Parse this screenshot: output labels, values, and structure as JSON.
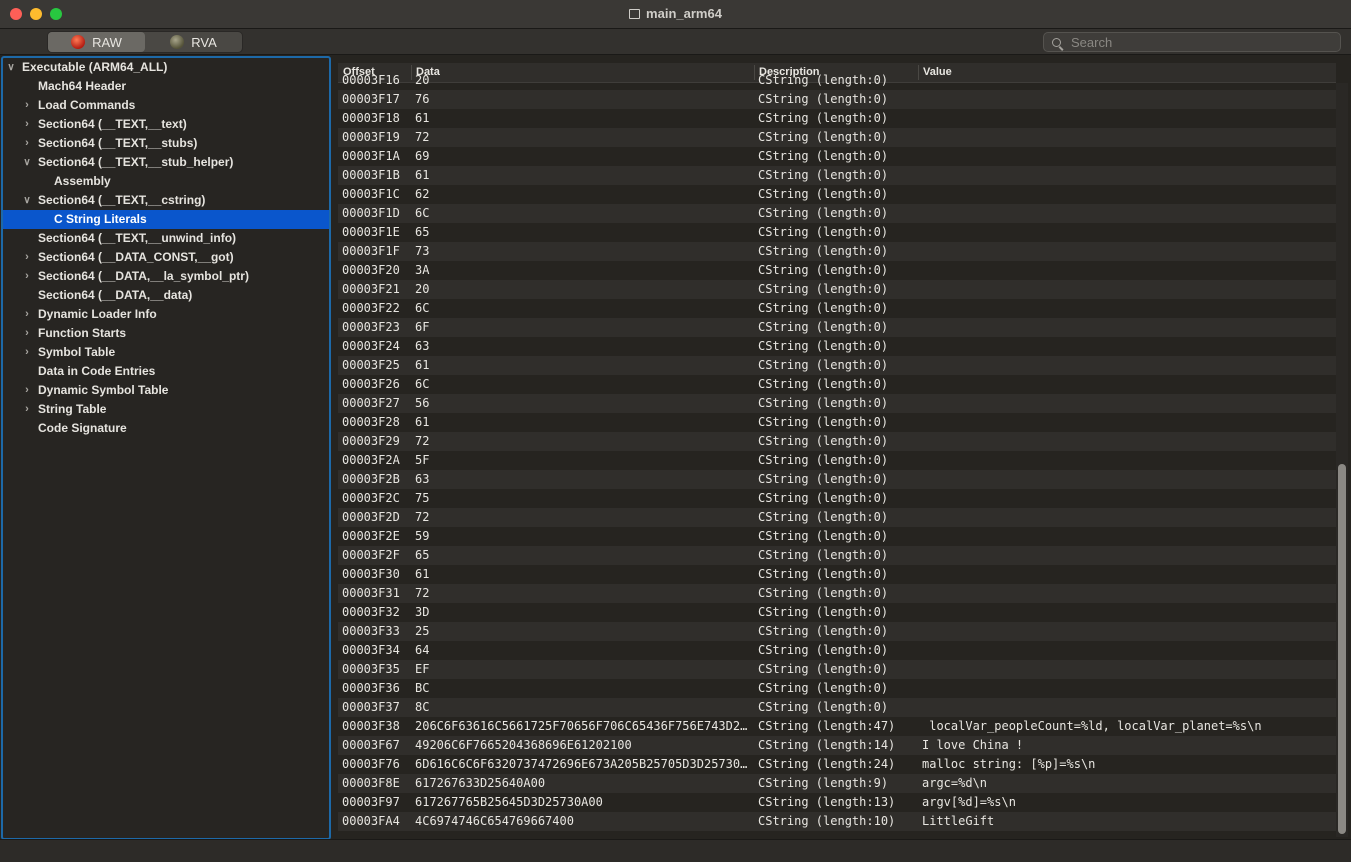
{
  "window": {
    "title": "main_arm64"
  },
  "toolbar": {
    "modes": [
      {
        "label": "RAW",
        "icon": "raw-icon",
        "active": true
      },
      {
        "label": "RVA",
        "icon": "rva-icon",
        "active": false
      }
    ],
    "search_placeholder": "Search"
  },
  "sidebar": {
    "items": [
      {
        "label": "Executable  (ARM64_ALL)",
        "level": 0,
        "chevron": "open"
      },
      {
        "label": "Mach64 Header",
        "level": 1,
        "chevron": "none"
      },
      {
        "label": "Load Commands",
        "level": 1,
        "chevron": "closed"
      },
      {
        "label": "Section64 (__TEXT,__text)",
        "level": 1,
        "chevron": "closed"
      },
      {
        "label": "Section64 (__TEXT,__stubs)",
        "level": 1,
        "chevron": "closed"
      },
      {
        "label": "Section64 (__TEXT,__stub_helper)",
        "level": 1,
        "chevron": "open"
      },
      {
        "label": "Assembly",
        "level": 2,
        "chevron": "none"
      },
      {
        "label": "Section64 (__TEXT,__cstring)",
        "level": 1,
        "chevron": "open"
      },
      {
        "label": "C String Literals",
        "level": 2,
        "chevron": "none",
        "selected": true
      },
      {
        "label": "Section64 (__TEXT,__unwind_info)",
        "level": 1,
        "chevron": "none"
      },
      {
        "label": "Section64 (__DATA_CONST,__got)",
        "level": 1,
        "chevron": "closed"
      },
      {
        "label": "Section64 (__DATA,__la_symbol_ptr)",
        "level": 1,
        "chevron": "closed"
      },
      {
        "label": "Section64 (__DATA,__data)",
        "level": 1,
        "chevron": "none"
      },
      {
        "label": "Dynamic Loader Info",
        "level": 1,
        "chevron": "closed"
      },
      {
        "label": "Function Starts",
        "level": 1,
        "chevron": "closed"
      },
      {
        "label": "Symbol Table",
        "level": 1,
        "chevron": "closed"
      },
      {
        "label": "Data in Code Entries",
        "level": 1,
        "chevron": "none"
      },
      {
        "label": "Dynamic Symbol Table",
        "level": 1,
        "chevron": "closed"
      },
      {
        "label": "String Table",
        "level": 1,
        "chevron": "closed"
      },
      {
        "label": "Code Signature",
        "level": 1,
        "chevron": "none"
      }
    ]
  },
  "table": {
    "columns": [
      {
        "label": "Offset"
      },
      {
        "label": "Data"
      },
      {
        "label": "Description"
      },
      {
        "label": "Value"
      }
    ],
    "rows": [
      [
        "00003F16",
        "20",
        "CString (length:0)",
        ""
      ],
      [
        "00003F17",
        "76",
        "CString (length:0)",
        ""
      ],
      [
        "00003F18",
        "61",
        "CString (length:0)",
        ""
      ],
      [
        "00003F19",
        "72",
        "CString (length:0)",
        ""
      ],
      [
        "00003F1A",
        "69",
        "CString (length:0)",
        ""
      ],
      [
        "00003F1B",
        "61",
        "CString (length:0)",
        ""
      ],
      [
        "00003F1C",
        "62",
        "CString (length:0)",
        ""
      ],
      [
        "00003F1D",
        "6C",
        "CString (length:0)",
        ""
      ],
      [
        "00003F1E",
        "65",
        "CString (length:0)",
        ""
      ],
      [
        "00003F1F",
        "73",
        "CString (length:0)",
        ""
      ],
      [
        "00003F20",
        "3A",
        "CString (length:0)",
        ""
      ],
      [
        "00003F21",
        "20",
        "CString (length:0)",
        ""
      ],
      [
        "00003F22",
        "6C",
        "CString (length:0)",
        ""
      ],
      [
        "00003F23",
        "6F",
        "CString (length:0)",
        ""
      ],
      [
        "00003F24",
        "63",
        "CString (length:0)",
        ""
      ],
      [
        "00003F25",
        "61",
        "CString (length:0)",
        ""
      ],
      [
        "00003F26",
        "6C",
        "CString (length:0)",
        ""
      ],
      [
        "00003F27",
        "56",
        "CString (length:0)",
        ""
      ],
      [
        "00003F28",
        "61",
        "CString (length:0)",
        ""
      ],
      [
        "00003F29",
        "72",
        "CString (length:0)",
        ""
      ],
      [
        "00003F2A",
        "5F",
        "CString (length:0)",
        ""
      ],
      [
        "00003F2B",
        "63",
        "CString (length:0)",
        ""
      ],
      [
        "00003F2C",
        "75",
        "CString (length:0)",
        ""
      ],
      [
        "00003F2D",
        "72",
        "CString (length:0)",
        ""
      ],
      [
        "00003F2E",
        "59",
        "CString (length:0)",
        ""
      ],
      [
        "00003F2F",
        "65",
        "CString (length:0)",
        ""
      ],
      [
        "00003F30",
        "61",
        "CString (length:0)",
        ""
      ],
      [
        "00003F31",
        "72",
        "CString (length:0)",
        ""
      ],
      [
        "00003F32",
        "3D",
        "CString (length:0)",
        ""
      ],
      [
        "00003F33",
        "25",
        "CString (length:0)",
        ""
      ],
      [
        "00003F34",
        "64",
        "CString (length:0)",
        ""
      ],
      [
        "00003F35",
        "EF",
        "CString (length:0)",
        ""
      ],
      [
        "00003F36",
        "BC",
        "CString (length:0)",
        ""
      ],
      [
        "00003F37",
        "8C",
        "CString (length:0)",
        ""
      ],
      [
        "00003F38",
        "206C6F63616C5661725F70656F706C65436F756E743D2…",
        "CString (length:47)",
        " localVar_peopleCount=%ld, localVar_planet=%s\\n"
      ],
      [
        "00003F67",
        "49206C6F7665204368696E61202100",
        "CString (length:14)",
        "I love China !"
      ],
      [
        "00003F76",
        "6D616C6C6F6320737472696E673A205B25705D3D25730…",
        "CString (length:24)",
        "malloc string: [%p]=%s\\n"
      ],
      [
        "00003F8E",
        "617267633D25640A00",
        "CString (length:9)",
        "argc=%d\\n"
      ],
      [
        "00003F97",
        "617267765B25645D3D25730A00",
        "CString (length:13)",
        "argv[%d]=%s\\n"
      ],
      [
        "00003FA4",
        "4C6974746C654769667400",
        "CString (length:10)",
        "LittleGift"
      ]
    ]
  }
}
